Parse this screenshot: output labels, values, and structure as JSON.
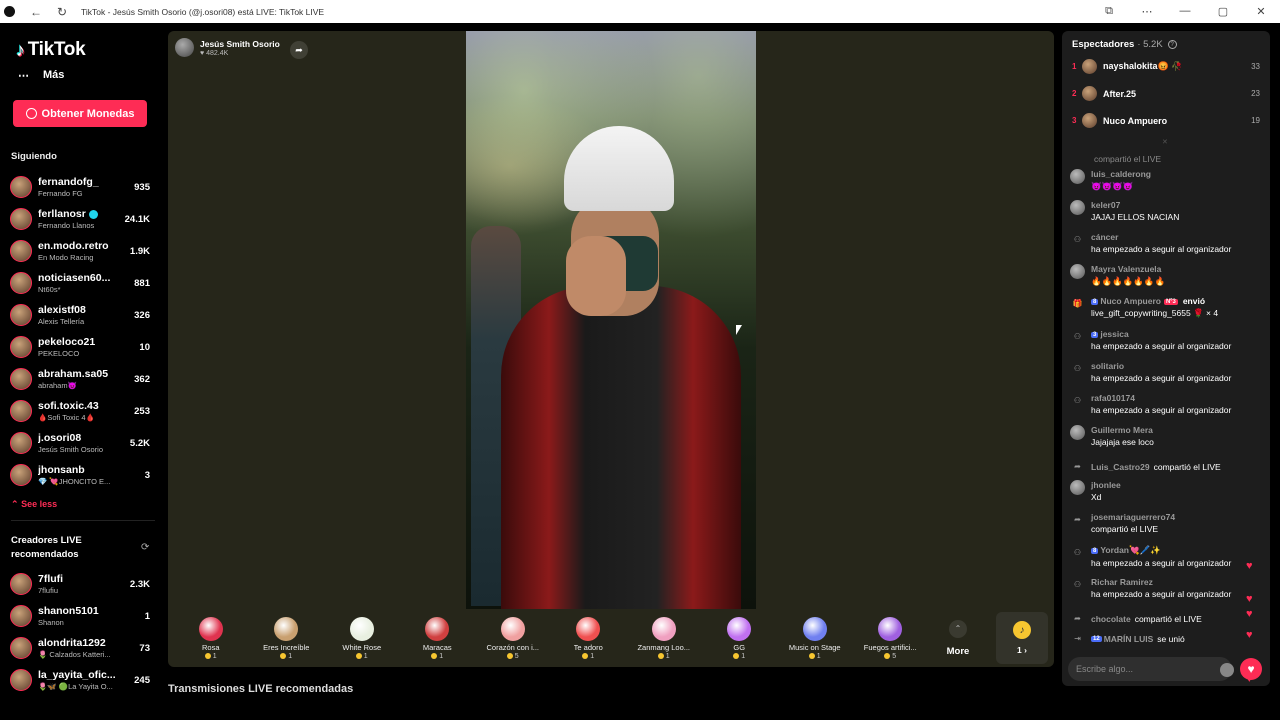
{
  "window": {
    "title": "TikTok - Jesús Smith Osorio (@j.osori08) está LIVE: TikTok LIVE"
  },
  "sidebar": {
    "logo": "TikTok",
    "more_label": "Más",
    "coins_button": "Obtener Monedas",
    "following_title": "Siguiendo",
    "following": [
      {
        "name": "fernandofg_",
        "sub": "Fernando FG",
        "count": "935"
      },
      {
        "name": "ferllanosr",
        "sub": "Fernando Llanos",
        "count": "24.1K",
        "verified": true
      },
      {
        "name": "en.modo.retro",
        "sub": "En Modo Racing",
        "count": "1.9K"
      },
      {
        "name": "noticiasen60...",
        "sub": "Nt60s*",
        "count": "881"
      },
      {
        "name": "alexistf08",
        "sub": "Alexis Tellería",
        "count": "326"
      },
      {
        "name": "pekeloco21",
        "sub": "PEKELOCO",
        "count": "10"
      },
      {
        "name": "abraham.sa05",
        "sub": "abraham😈",
        "count": "362"
      },
      {
        "name": "sofi.toxic.43",
        "sub": "🩸Sofi Toxic 4🩸",
        "count": "253"
      },
      {
        "name": "j.osori08",
        "sub": "Jesús Smith Osorio",
        "count": "5.2K"
      },
      {
        "name": "jhonsanb",
        "sub": "💎 💘JHONCITO E...",
        "count": "3"
      }
    ],
    "see_less": "See less",
    "recommended_title": "Creadores LIVE recomendados",
    "recommended": [
      {
        "name": "7flufi",
        "sub": "7flufiu",
        "count": "2.3K"
      },
      {
        "name": "shanon5101",
        "sub": "Shanon",
        "count": "1"
      },
      {
        "name": "alondrita1292",
        "sub": "🌷 Calzados Katteri...",
        "count": "73"
      },
      {
        "name": "la_yayita_ofic...",
        "sub": "🌷🦋 🟢La Yayita O...",
        "count": "245"
      }
    ]
  },
  "stream": {
    "streamer_name": "Jesús Smith Osorio",
    "likes": "♥ 482.4K"
  },
  "gifts": [
    {
      "name": "Rosa",
      "cost": "1",
      "color": "#e0334f"
    },
    {
      "name": "Eres Increíble",
      "cost": "1",
      "color": "#c9a070"
    },
    {
      "name": "White Rose",
      "cost": "1",
      "color": "#e8efe0"
    },
    {
      "name": "Maracas",
      "cost": "1",
      "color": "#d04040"
    },
    {
      "name": "Corazón con i...",
      "cost": "5",
      "color": "#f0a0a0"
    },
    {
      "name": "Te adoro",
      "cost": "1",
      "color": "#f05050"
    },
    {
      "name": "Zanmang Loo...",
      "cost": "1",
      "color": "#f0a0c0"
    },
    {
      "name": "GG",
      "cost": "1",
      "color": "#c070f0"
    },
    {
      "name": "Music on Stage",
      "cost": "1",
      "color": "#7080f0"
    },
    {
      "name": "Fuegos artifici...",
      "cost": "5",
      "color": "#a060e0"
    }
  ],
  "more_label": "More",
  "wallet_count": "1 ›",
  "recommended_live_title": "Transmisiones LIVE recomendadas",
  "chat": {
    "spectators_label": "Espectadores",
    "spectators_count": "· 5.2K",
    "top_viewers": [
      {
        "rank": "1",
        "name": "nayshalokita😡 🥀",
        "score": "33"
      },
      {
        "rank": "2",
        "name": "After.25",
        "score": "23"
      },
      {
        "rank": "3",
        "name": "Nuco Ampuero",
        "score": "19"
      }
    ],
    "partial_line": "compartió el LIVE",
    "messages": [
      {
        "name": "luis_calderong",
        "text": "😈😈😈😈",
        "icon": "avatar"
      },
      {
        "name": "keler07",
        "text": "JAJAJ ELLOS NACIAN",
        "icon": "avatar"
      },
      {
        "name": "cáncer",
        "text": "ha empezado a seguir al organizador",
        "icon": "follow"
      },
      {
        "name": "Mayra Valenzuela",
        "text": "🔥🔥🔥🔥🔥🔥🔥",
        "icon": "avatar"
      },
      {
        "name": "Nuco Ampuero",
        "badge": "8",
        "badge2": "Nº3",
        "action": "envió",
        "text": "live_gift_copywriting_5655 🌹 × 4",
        "icon": "gift"
      },
      {
        "name": "jessica",
        "badge": "3",
        "text": "ha empezado a seguir al organizador",
        "icon": "follow"
      },
      {
        "name": "solitario",
        "text": "ha empezado a seguir al organizador",
        "icon": "follow"
      },
      {
        "name": "rafa010174",
        "text": "ha empezado a seguir al organizador",
        "icon": "follow"
      },
      {
        "name": "Guillermo Mera",
        "text": "Jajajaja ese loco",
        "icon": "avatar"
      },
      {
        "name": "Luis_Castro29",
        "text": "compartió el LIVE",
        "icon": "share",
        "inline": true
      },
      {
        "name": "jhonlee",
        "text": "Xd",
        "icon": "avatar"
      },
      {
        "name": "josemariaguerrero74",
        "text": "compartió el LIVE",
        "icon": "share"
      },
      {
        "name": "Yordan💘🖊️✨",
        "badge": "8",
        "text": "ha empezado a seguir al organizador",
        "icon": "follow"
      },
      {
        "name": "Richar Ramirez",
        "text": "ha empezado a seguir al organizador",
        "icon": "follow"
      },
      {
        "name": "chocolate",
        "text": "compartió el LIVE",
        "icon": "share",
        "inline": true
      },
      {
        "name": "MARÍN LUIS",
        "badge": "12",
        "text": "se unió",
        "icon": "join",
        "inline": true
      }
    ],
    "input_placeholder": "Escribe algo..."
  },
  "colors": {
    "accent": "#fe2c55",
    "coin": "#f7c630",
    "stream_bg": "#26261a",
    "chat_bg": "#1d1d1d"
  }
}
